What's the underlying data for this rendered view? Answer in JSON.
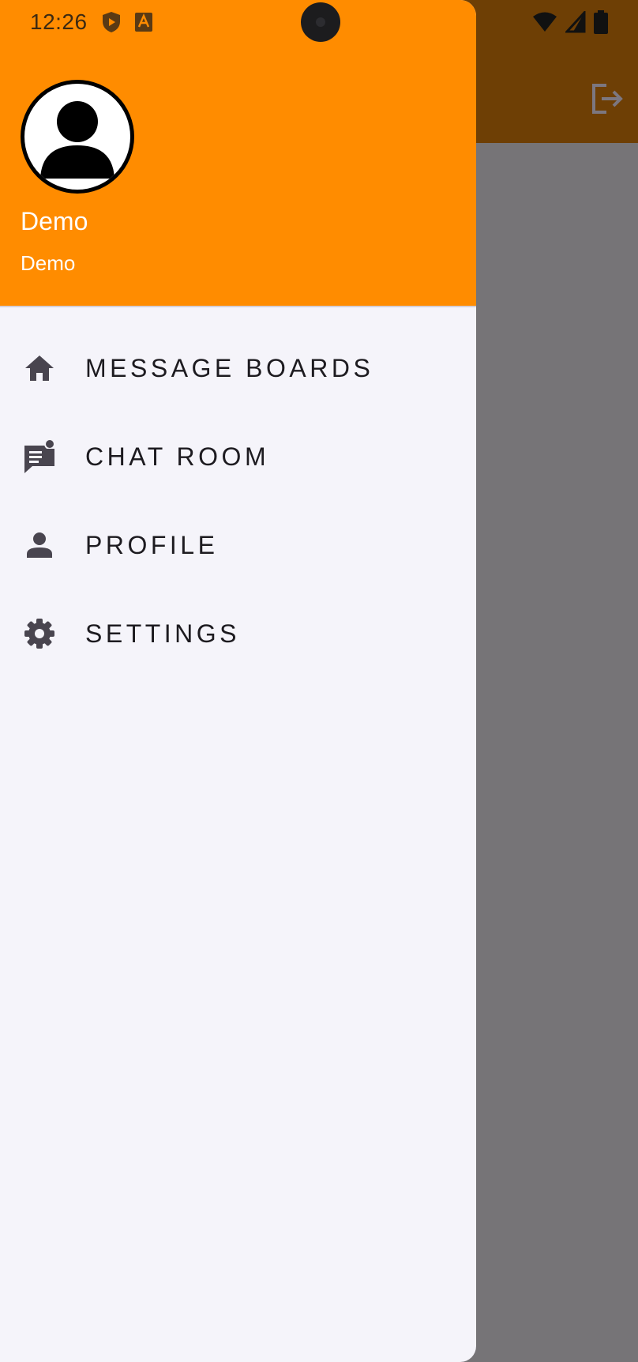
{
  "status_bar": {
    "time": "12:26"
  },
  "drawer": {
    "header": {
      "name": "Demo",
      "subtitle": "Demo",
      "background_color": "#ff8c00"
    },
    "items": [
      {
        "label": "MESSAGE BOARDS",
        "icon": "home-icon"
      },
      {
        "label": "CHAT ROOM",
        "icon": "chat-icon"
      },
      {
        "label": "PROFILE",
        "icon": "person-icon"
      },
      {
        "label": "SETTINGS",
        "icon": "gear-icon"
      }
    ]
  },
  "app_bar": {
    "action_icon": "logout-icon"
  }
}
